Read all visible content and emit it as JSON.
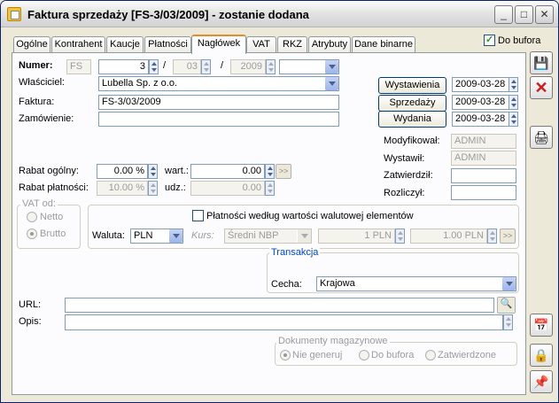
{
  "window": {
    "title": "Faktura sprzedaży [FS-3/03/2009]  - zostanie dodana"
  },
  "tabs": [
    "Ogólne",
    "Kontrahent",
    "Kaucje",
    "Płatności",
    "Nagłówek",
    "VAT",
    "RKZ",
    "Atrybuty",
    "Dane binarne"
  ],
  "do_bufora": {
    "label": "Do bufora",
    "checked": true
  },
  "numer": {
    "label": "Numer:",
    "prefix": "FS",
    "number": "3",
    "month": "03",
    "year": "2009",
    "sep": "/"
  },
  "wlasciciel": {
    "label": "Właściciel:",
    "value": "Lubella Sp. z o.o."
  },
  "faktura": {
    "label": "Faktura:",
    "value": "FS-3/03/2009"
  },
  "zamowienie": {
    "label": "Zamówienie:",
    "value": ""
  },
  "dates": {
    "wystawienia": {
      "label": "Wystawienia",
      "value": "2009-03-28"
    },
    "sprzedazy": {
      "label": "Sprzedaży",
      "value": "2009-03-28"
    },
    "wydania": {
      "label": "Wydania",
      "value": "2009-03-28"
    }
  },
  "audit": {
    "modyfikowal": {
      "label": "Modyfikował:",
      "value": "ADMIN"
    },
    "wystawil": {
      "label": "Wystawił:",
      "value": "ADMIN"
    },
    "zatwierdzil": {
      "label": "Zatwierdził:",
      "value": ""
    },
    "rozliczyl": {
      "label": "Rozliczył:",
      "value": ""
    }
  },
  "rabat": {
    "ogolny_label": "Rabat ogólny:",
    "ogolny": "0.00 %",
    "wart_label": "wart.:",
    "wart": "0.00",
    "platnosci_label": "Rabat płatności:",
    "platnosci": "10.00 %",
    "udz_label": "udz.:",
    "udz": "0.00",
    "more": ">>"
  },
  "vat_od": {
    "title": "VAT od:",
    "netto": "Netto",
    "brutto": "Brutto",
    "selected": "brutto"
  },
  "platnosci_wedlug": {
    "label": "Płatności według wartości walutowej elementów",
    "checked": false
  },
  "waluta": {
    "label": "Waluta:",
    "value": "PLN",
    "kurs_label": "Kurs:",
    "kurs": "Średni NBP",
    "rate1": "1 PLN",
    "rate2": "1.00 PLN",
    "more": ">>"
  },
  "transakcja": {
    "title": "Transakcja",
    "cecha_label": "Cecha:",
    "cecha": "Krajowa"
  },
  "url": {
    "label": "URL:",
    "value": ""
  },
  "opis": {
    "label": "Opis:",
    "value": ""
  },
  "dokumenty": {
    "title": "Dokumenty magazynowe",
    "opt1": "Nie generuj",
    "opt2": "Do bufora",
    "opt3": "Zatwierdzone",
    "selected": "Nie generuj"
  },
  "colors": {
    "accent": "#e68b2c",
    "save": "#1f3f9f",
    "cancel": "#d11a1a"
  }
}
